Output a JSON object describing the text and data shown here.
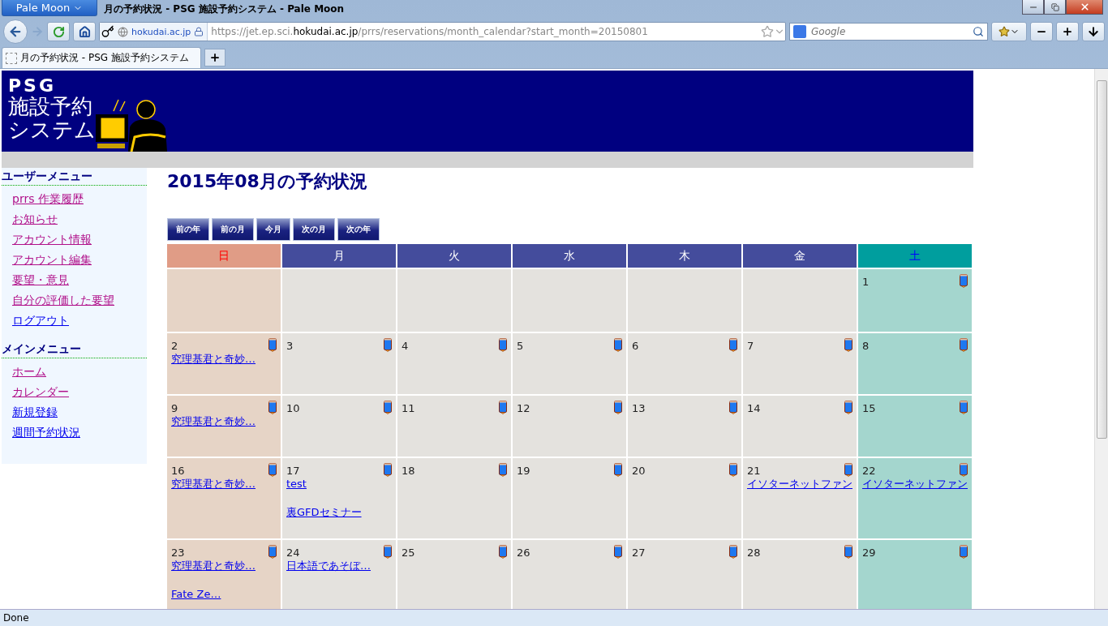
{
  "browser": {
    "app_menu": "Pale Moon",
    "window_title": "月の予約状況 - PSG 施設予約システム - Pale Moon",
    "identity": "hokudai.ac.jp",
    "url": {
      "prefix": "https://jet.ep.sci.",
      "host": "hokudai.ac.jp",
      "suffix": "/prrs/reservations/month_calendar?start_month=20150801"
    },
    "search": {
      "placeholder": "Google"
    },
    "tab": {
      "title": "月の予約状況 - PSG 施設予約システム",
      "selected": true
    },
    "status_bar": "Done"
  },
  "header": {
    "logo_lines": [
      "PSG",
      "施設予約",
      "システム"
    ]
  },
  "sidebar": [
    {
      "heading": "ユーザーメニュー",
      "items": [
        {
          "label": "prrs 作業履歴",
          "visited": true
        },
        {
          "label": "お知らせ",
          "visited": true
        },
        {
          "label": "アカウント情報",
          "visited": true
        },
        {
          "label": "アカウント編集",
          "visited": true
        },
        {
          "label": "要望・意見",
          "visited": true
        },
        {
          "label": "自分の評価した要望",
          "visited": true
        },
        {
          "label": "ログアウト",
          "visited": false
        }
      ]
    },
    {
      "heading": "メインメニュー",
      "items": [
        {
          "label": "ホーム",
          "visited": true
        },
        {
          "label": "カレンダー",
          "visited": true
        },
        {
          "label": "新規登録",
          "visited": false
        },
        {
          "label": "週間予約状況",
          "visited": false
        }
      ]
    }
  ],
  "title": "2015年08月の予約状況",
  "nav_buttons": [
    "前の年",
    "前の月",
    "今月",
    "次の月",
    "次の年"
  ],
  "calendar": {
    "weekdays": [
      {
        "label": "日",
        "kind": "sunday"
      },
      {
        "label": "月",
        "kind": "weekday"
      },
      {
        "label": "火",
        "kind": "weekday"
      },
      {
        "label": "水",
        "kind": "weekday"
      },
      {
        "label": "木",
        "kind": "weekday"
      },
      {
        "label": "金",
        "kind": "weekday"
      },
      {
        "label": "土",
        "kind": "saturday"
      }
    ],
    "weeks": [
      [
        {
          "kind": "blank"
        },
        {
          "kind": "blank"
        },
        {
          "kind": "blank"
        },
        {
          "kind": "blank"
        },
        {
          "kind": "blank"
        },
        {
          "kind": "blank"
        },
        {
          "kind": "day",
          "day": "1"
        }
      ],
      [
        {
          "kind": "day",
          "day": "2",
          "events": [
            "究理基君と奇妙…"
          ]
        },
        {
          "kind": "day",
          "day": "3"
        },
        {
          "kind": "day",
          "day": "4"
        },
        {
          "kind": "day",
          "day": "5"
        },
        {
          "kind": "day",
          "day": "6"
        },
        {
          "kind": "day",
          "day": "7"
        },
        {
          "kind": "day",
          "day": "8"
        }
      ],
      [
        {
          "kind": "day",
          "day": "9",
          "events": [
            "究理基君と奇妙…"
          ]
        },
        {
          "kind": "day",
          "day": "10"
        },
        {
          "kind": "day",
          "day": "11"
        },
        {
          "kind": "day",
          "day": "12"
        },
        {
          "kind": "day",
          "day": "13"
        },
        {
          "kind": "day",
          "day": "14"
        },
        {
          "kind": "day",
          "day": "15"
        }
      ],
      [
        {
          "kind": "day",
          "day": "16",
          "events": [
            "究理基君と奇妙…"
          ]
        },
        {
          "kind": "day",
          "day": "17",
          "events": [
            "test",
            "裏GFDセミナー"
          ]
        },
        {
          "kind": "day",
          "day": "18"
        },
        {
          "kind": "day",
          "day": "19"
        },
        {
          "kind": "day",
          "day": "20"
        },
        {
          "kind": "day",
          "day": "21",
          "events": [
            "イソターネットファン"
          ]
        },
        {
          "kind": "day",
          "day": "22",
          "events": [
            "イソターネットファン"
          ]
        }
      ],
      [
        {
          "kind": "day",
          "day": "23",
          "events": [
            "究理基君と奇妙…",
            "Fate Ze…"
          ]
        },
        {
          "kind": "day",
          "day": "24",
          "events": [
            "日本語であそぼ…"
          ]
        },
        {
          "kind": "day",
          "day": "25"
        },
        {
          "kind": "day",
          "day": "26"
        },
        {
          "kind": "day",
          "day": "27"
        },
        {
          "kind": "day",
          "day": "28"
        },
        {
          "kind": "day",
          "day": "29"
        }
      ]
    ]
  }
}
